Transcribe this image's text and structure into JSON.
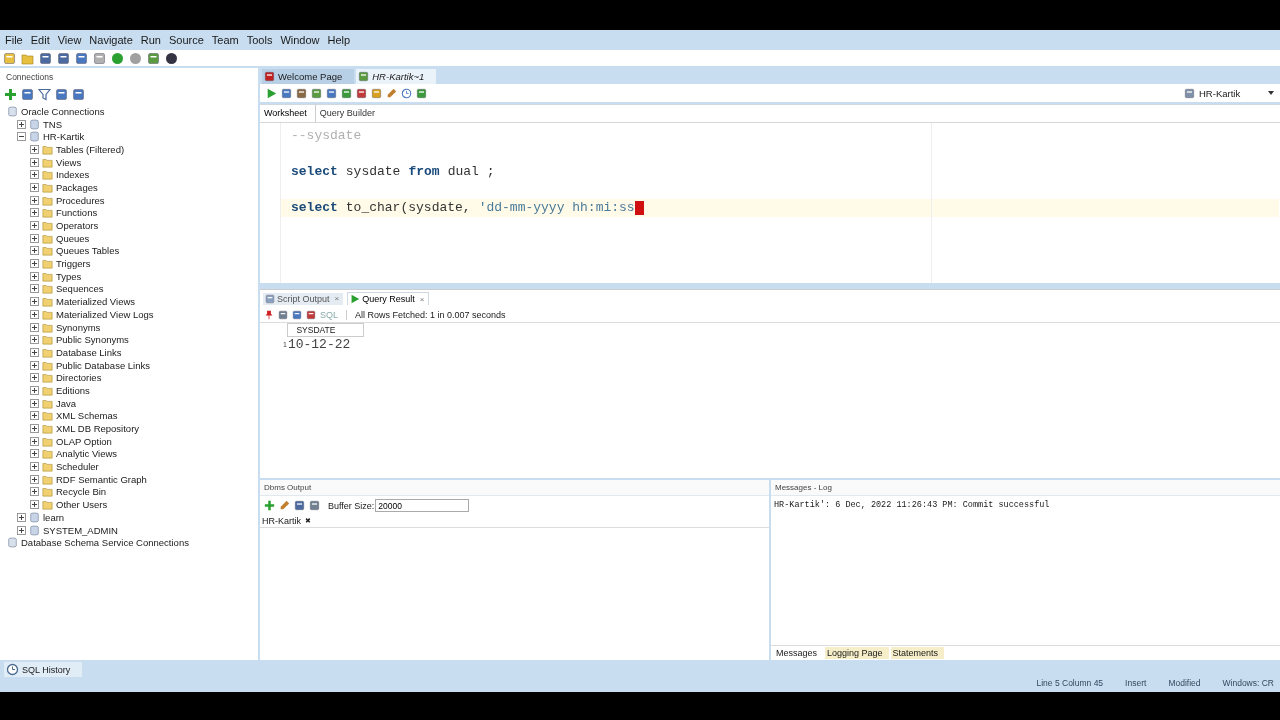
{
  "menu": [
    "File",
    "Edit",
    "View",
    "Navigate",
    "Run",
    "Source",
    "Team",
    "Tools",
    "Window",
    "Help"
  ],
  "connections": {
    "title": "Connections",
    "tree": [
      {
        "label": "Oracle Connections",
        "children": [
          {
            "label": "TNS",
            "expanded": false
          },
          {
            "label": "HR-Kartik",
            "expanded": true,
            "children": [
              {
                "label": "Tables (Filtered)",
                "expanded": false
              },
              {
                "label": "Views",
                "expanded": false
              },
              {
                "label": "Indexes",
                "expanded": false
              },
              {
                "label": "Packages",
                "expanded": false
              },
              {
                "label": "Procedures",
                "expanded": false
              },
              {
                "label": "Functions",
                "expanded": false
              },
              {
                "label": "Operators",
                "expanded": false
              },
              {
                "label": "Queues",
                "expanded": false
              },
              {
                "label": "Queues Tables",
                "expanded": false
              },
              {
                "label": "Triggers",
                "expanded": false
              },
              {
                "label": "Types",
                "expanded": false
              },
              {
                "label": "Sequences",
                "expanded": false
              },
              {
                "label": "Materialized Views",
                "expanded": false
              },
              {
                "label": "Materialized View Logs",
                "expanded": false
              },
              {
                "label": "Synonyms",
                "expanded": false
              },
              {
                "label": "Public Synonyms",
                "expanded": false
              },
              {
                "label": "Database Links",
                "expanded": false
              },
              {
                "label": "Public Database Links",
                "expanded": false
              },
              {
                "label": "Directories",
                "expanded": false
              },
              {
                "label": "Editions",
                "expanded": false
              },
              {
                "label": "Java",
                "expanded": false
              },
              {
                "label": "XML Schemas",
                "expanded": false
              },
              {
                "label": "XML DB Repository",
                "expanded": false
              },
              {
                "label": "OLAP Option",
                "expanded": false
              },
              {
                "label": "Analytic Views",
                "expanded": false
              },
              {
                "label": "Scheduler",
                "expanded": false
              },
              {
                "label": "RDF Semantic Graph",
                "expanded": false
              },
              {
                "label": "Recycle Bin",
                "expanded": false
              },
              {
                "label": "Other Users",
                "expanded": false
              }
            ]
          },
          {
            "label": "learn",
            "expanded": false
          },
          {
            "label": "SYSTEM_ADMIN",
            "expanded": false
          }
        ]
      },
      {
        "label": "Database Schema Service Connections"
      }
    ]
  },
  "editor_tabs": [
    {
      "label": "Welcome Page",
      "selected": false
    },
    {
      "label": "HR-Kartik~1",
      "selected": true
    }
  ],
  "connection_selector": "HR-Kartik",
  "worksheet_tabs": [
    {
      "label": "Worksheet",
      "selected": true
    },
    {
      "label": "Query Builder",
      "selected": false
    }
  ],
  "code_lines": [
    {
      "kind": "code",
      "current": false,
      "cursor": false,
      "tokens": [
        {
          "kind": "comment",
          "text": "--sysdate"
        }
      ]
    },
    {
      "kind": "blank"
    },
    {
      "kind": "code",
      "current": false,
      "cursor": false,
      "tokens": [
        {
          "kind": "keyword",
          "text": "select"
        },
        {
          "kind": "plain",
          "text": "sysdate"
        },
        {
          "kind": "keyword",
          "text": "from"
        },
        {
          "kind": "plain",
          "text": "dual ;"
        }
      ]
    },
    {
      "kind": "blank"
    },
    {
      "kind": "code",
      "current": true,
      "cursor": true,
      "tokens": [
        {
          "kind": "keyword",
          "text": "select"
        },
        {
          "kind": "plain",
          "text": "to_char(sysdate,"
        },
        {
          "kind": "string",
          "text": "'dd-mm-yyyy hh:mi:ss"
        }
      ]
    }
  ],
  "result_tabs": [
    {
      "label": "Script Output",
      "close": "×",
      "selected": false
    },
    {
      "label": "Query Result",
      "close": "×",
      "selected": true
    }
  ],
  "result_toolbar": {
    "sql_label": "SQL",
    "status": "All Rows Fetched: 1 in 0.007 seconds"
  },
  "result_table": {
    "columns": [
      "SYSDATE"
    ],
    "rows": [
      {
        "number": "1",
        "cells": [
          "10-12-22"
        ]
      }
    ]
  },
  "dbms_output": {
    "title": "Dbms Output",
    "buffer_label": "Buffer Size:",
    "buffer_value": "20000",
    "tab": "HR-Kartik",
    "tab_close": "✖"
  },
  "messages_log": {
    "title": "Messages - Log",
    "lines": [
      "HR-Kartik': 6 Dec, 2022 11:26:43 PM: Commit successful"
    ],
    "tabs": [
      {
        "label": "Messages",
        "selected": true
      },
      {
        "label": "Logging Page",
        "selected": false
      },
      {
        "label": "Statements",
        "selected": false
      }
    ]
  },
  "sql_history": "SQL History",
  "status_bar": [
    "Line 5 Column 45",
    "Insert",
    "Modified",
    "Windows: CR"
  ]
}
